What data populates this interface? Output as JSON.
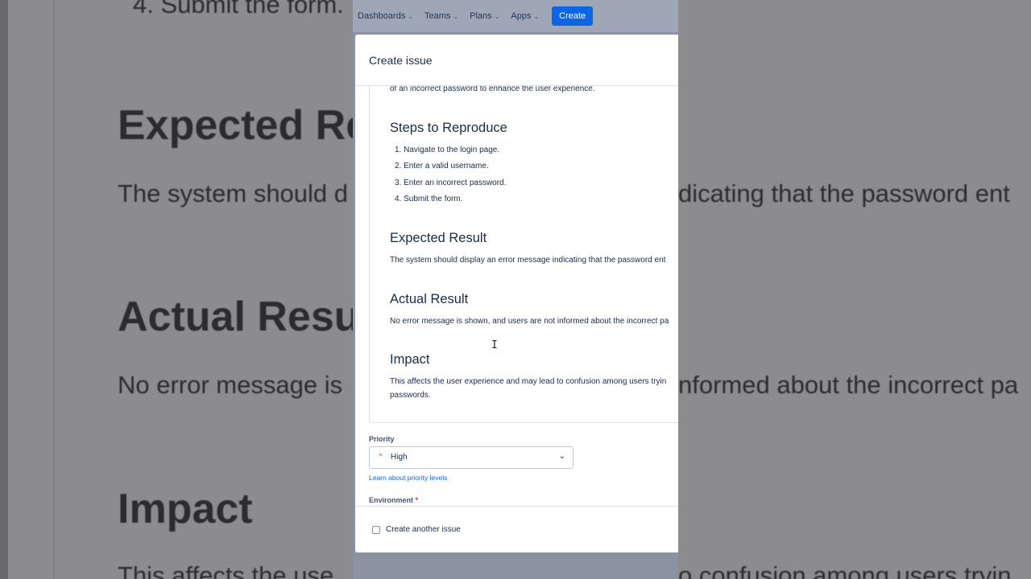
{
  "background": {
    "lines": [
      "4. Submit the form.",
      "Expected Re",
      "The system should d",
      "dicating that the password ent",
      "Actual Resul",
      "No error message is",
      "nformed about the incorrect pa",
      "Impact",
      "This affects the use",
      "o confusion among users tryin"
    ]
  },
  "nav": {
    "items": [
      "Dashboards",
      "Teams",
      "Plans",
      "Apps"
    ],
    "create_label": "Create"
  },
  "modal": {
    "title": "Create issue",
    "editor": {
      "intro_tail": "of an incorrect password to enhance the user experience.",
      "steps_heading": "Steps to Reproduce",
      "steps": [
        "1. Navigate to the login page.",
        "2. Enter a valid username.",
        "3. Enter an incorrect password.",
        "4. Submit the form."
      ],
      "expected_heading": "Expected Result",
      "expected_text": "The system should display an error message indicating that the password ent",
      "actual_heading": "Actual Result",
      "actual_text": "No error message is shown, and users are not informed about the incorrect pa",
      "impact_heading": "Impact",
      "impact_text_1": "This affects the user experience and may lead to confusion among users tryin",
      "impact_text_2": "passwords."
    },
    "priority": {
      "label": "Priority",
      "value": "High",
      "icon": "priority-high-icon",
      "icon_color": "#e34935",
      "learn_link": "Learn about priority levels"
    },
    "environment": {
      "label": "Environment",
      "required_mark": "*"
    },
    "footer": {
      "create_another_label": "Create another issue",
      "create_another_checked": false
    }
  },
  "colors": {
    "accent": "#0c66e4",
    "text": "#172b4d"
  }
}
